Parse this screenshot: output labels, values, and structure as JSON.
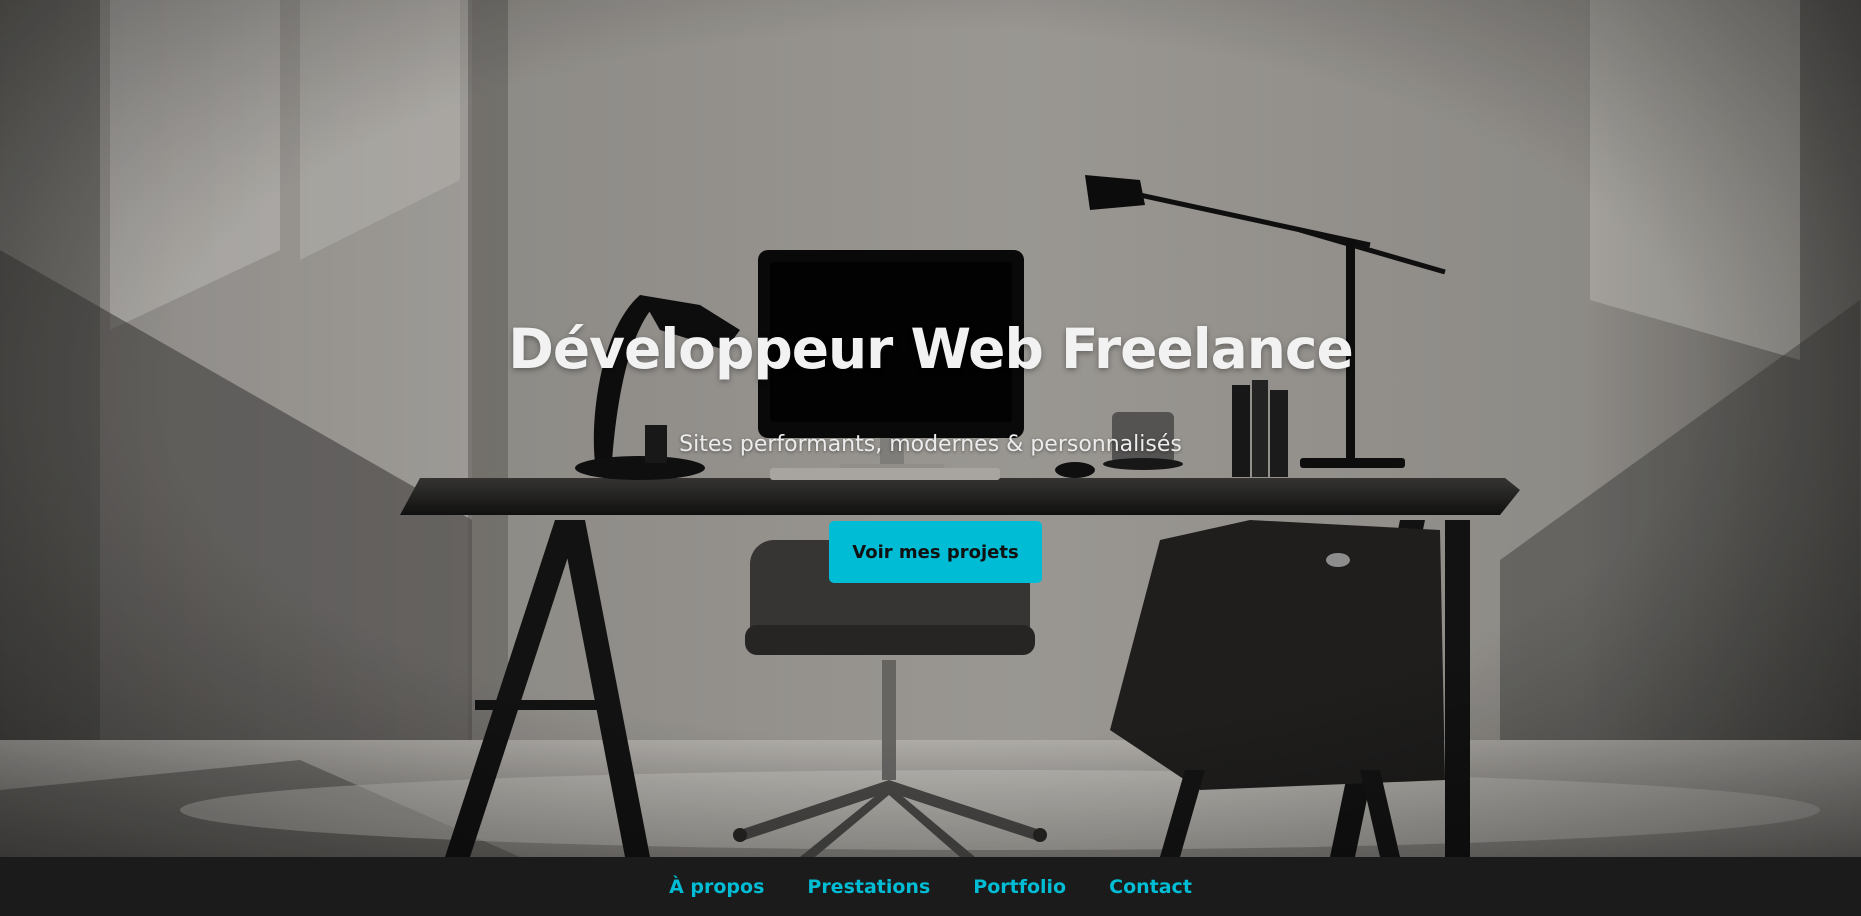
{
  "hero": {
    "title": "Développeur Web Freelance",
    "subtitle": "Sites performants, modernes & personnalisés",
    "cta_label": "Voir mes projets"
  },
  "nav": {
    "items": [
      {
        "label": "À propos"
      },
      {
        "label": "Prestations"
      },
      {
        "label": "Portfolio"
      },
      {
        "label": "Contact"
      }
    ]
  },
  "colors": {
    "accent": "#00bcd4",
    "nav_background": "#1b1b1b",
    "title_text": "#f2f2f2"
  }
}
